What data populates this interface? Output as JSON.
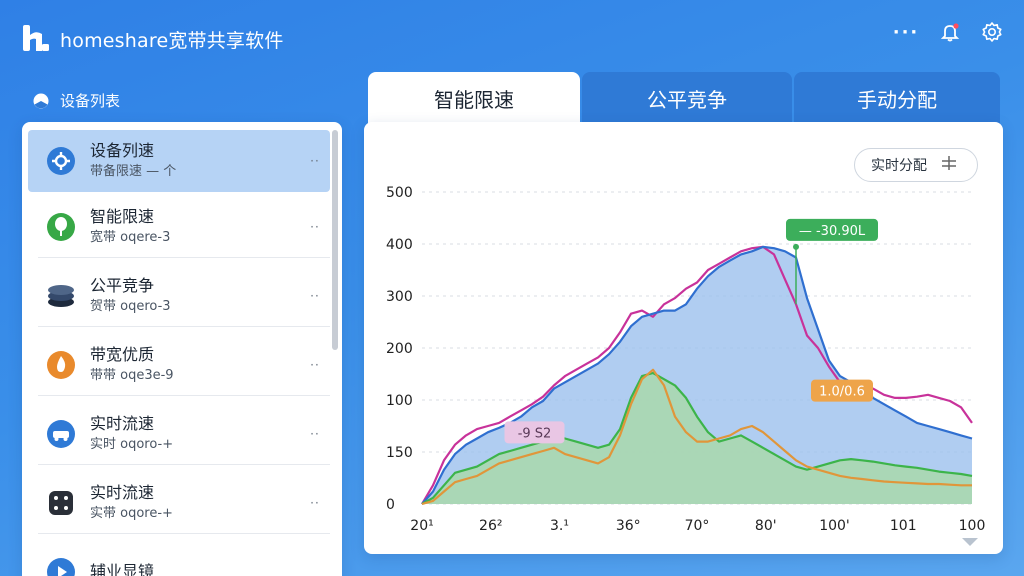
{
  "app": {
    "title": "homeshare宽带共享软件"
  },
  "titlebar": {
    "more_icon": "more-dots-icon",
    "bell_icon": "bell-icon",
    "gear_icon": "gear-icon"
  },
  "sidebar": {
    "header": "设备列表",
    "items": [
      {
        "name": "设备列速",
        "sub": "带备限速 — 个",
        "icon": "gear-shield-icon",
        "color": "#2f7ad6",
        "active": true
      },
      {
        "name": "智能限速",
        "sub": "宽带 oqere-3",
        "icon": "tree-icon",
        "color": "#37a846"
      },
      {
        "name": "公平竞争",
        "sub": "贺带 oqero-3",
        "icon": "layers-icon",
        "color": "#2b3b55"
      },
      {
        "name": "带宽优质",
        "sub": "带带 oqe3e-9",
        "icon": "flame-icon",
        "color": "#e98a2c"
      },
      {
        "name": "实时流速",
        "sub": "实时 oqoro-+",
        "icon": "car-icon",
        "color": "#2f7ad6"
      },
      {
        "name": "实时流速",
        "sub": "实带 oqore-+",
        "icon": "dice-icon",
        "color": "#2a2f38"
      },
      {
        "name": "辅业显镜",
        "sub": "",
        "icon": "play-icon",
        "color": "#2f7ad6"
      }
    ],
    "more_label": "··"
  },
  "tabs": [
    {
      "label": "智能限速",
      "active": true
    },
    {
      "label": "公平竞争",
      "active": false
    },
    {
      "label": "手动分配",
      "active": false
    }
  ],
  "panel": {
    "realtime_button": "实时分配",
    "realtime_icon": "sliders-icon"
  },
  "chart_data": {
    "type": "area",
    "yticks": [
      "500",
      "400",
      "300",
      "200",
      "100",
      "150",
      "0"
    ],
    "xticks": [
      "20¹",
      "26²",
      "3.¹",
      "36°",
      "70°",
      "80'",
      "100'",
      "101",
      "100"
    ],
    "ylim": [
      0,
      500
    ],
    "x": [
      0,
      2,
      4,
      6,
      8,
      10,
      12,
      14,
      16,
      18,
      20,
      22,
      24,
      26,
      28,
      30,
      32,
      34,
      36,
      38,
      40,
      42,
      44,
      46,
      48,
      50,
      52,
      54,
      56,
      58,
      60,
      62,
      64,
      66,
      68,
      70,
      72,
      74,
      76,
      78,
      80,
      82,
      84,
      86,
      88,
      90,
      92,
      94,
      96,
      98,
      100
    ],
    "series": [
      {
        "color": "#c8329a",
        "values": [
          0,
          30,
          70,
          95,
          110,
          120,
          125,
          130,
          140,
          150,
          160,
          172,
          190,
          205,
          215,
          225,
          235,
          250,
          275,
          305,
          310,
          300,
          320,
          330,
          345,
          355,
          375,
          385,
          395,
          405,
          410,
          412,
          400,
          360,
          320,
          270,
          250,
          220,
          195,
          190,
          185,
          185,
          175,
          170,
          170,
          172,
          175,
          170,
          165,
          155,
          130
        ]
      },
      {
        "color": "#2f6fd0",
        "fill": "#9cc0ee",
        "values": [
          0,
          20,
          55,
          80,
          95,
          105,
          115,
          122,
          130,
          140,
          155,
          165,
          185,
          195,
          205,
          215,
          225,
          240,
          260,
          285,
          300,
          305,
          310,
          310,
          320,
          345,
          365,
          380,
          390,
          400,
          405,
          412,
          410,
          405,
          395,
          330,
          280,
          230,
          205,
          195,
          190,
          170,
          160,
          150,
          140,
          130,
          125,
          120,
          115,
          110,
          105
        ]
      },
      {
        "color": "#3cb44a",
        "fill": "#a9d9a8",
        "values": [
          0,
          10,
          30,
          50,
          55,
          60,
          70,
          80,
          85,
          90,
          95,
          100,
          110,
          105,
          100,
          95,
          90,
          95,
          120,
          170,
          205,
          210,
          200,
          190,
          170,
          140,
          115,
          100,
          105,
          110,
          100,
          90,
          80,
          70,
          60,
          55,
          60,
          65,
          70,
          72,
          70,
          68,
          65,
          62,
          60,
          58,
          55,
          52,
          50,
          48,
          45
        ]
      },
      {
        "color": "#e0963a",
        "values": [
          0,
          5,
          20,
          35,
          40,
          45,
          55,
          65,
          70,
          75,
          80,
          85,
          90,
          80,
          75,
          70,
          65,
          75,
          110,
          160,
          200,
          215,
          190,
          140,
          115,
          100,
          100,
          105,
          110,
          120,
          125,
          115,
          100,
          85,
          70,
          60,
          55,
          50,
          45,
          42,
          40,
          38,
          36,
          35,
          34,
          33,
          32,
          32,
          31,
          30,
          30
        ]
      }
    ],
    "annotations": [
      {
        "text": "— -30.90L",
        "bg": "#3cae5b",
        "fg": "#ffffff"
      },
      {
        "text": "1.0/0.6",
        "bg": "#eea44a",
        "fg": "#ffffff"
      },
      {
        "text": "-9 S2",
        "bg": "#e9c6e4",
        "fg": "#5a3a58"
      }
    ]
  }
}
